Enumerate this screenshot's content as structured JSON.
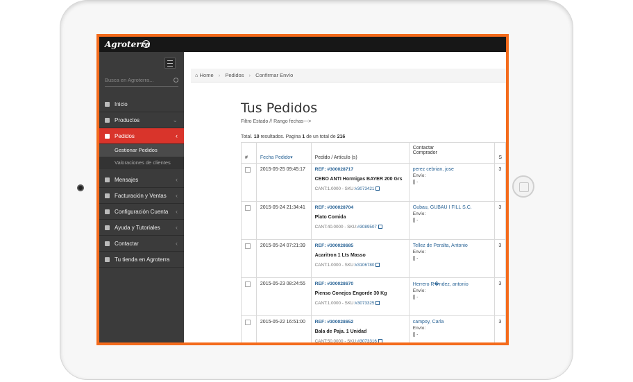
{
  "app": {
    "logo_text": "Agroterra"
  },
  "sidebar": {
    "search_placeholder": "Busca en Agroterra...",
    "items": [
      {
        "label": "Inicio",
        "icon": "home-icon",
        "chevron": ""
      },
      {
        "label": "Productos",
        "icon": "list-icon",
        "chevron": "⌄"
      },
      {
        "label": "Pedidos",
        "icon": "orders-icon",
        "chevron": "‹"
      },
      {
        "label": "Mensajes",
        "icon": "inbox-icon",
        "chevron": "‹"
      },
      {
        "label": "Facturación y Ventas",
        "icon": "euro-icon",
        "chevron": "‹"
      },
      {
        "label": "Configuración Cuenta",
        "icon": "gears-icon",
        "chevron": "‹"
      },
      {
        "label": "Ayuda y Tutoriales",
        "icon": "thumbs-up-icon",
        "chevron": "‹"
      },
      {
        "label": "Contactar",
        "icon": "megaphone-icon",
        "chevron": "‹"
      },
      {
        "label": "Tu tienda en Agroterra",
        "icon": "external-link-icon",
        "chevron": ""
      }
    ],
    "sub_items": [
      {
        "label": "Gestionar Pedidos"
      },
      {
        "label": "Valoraciones de clientes"
      }
    ]
  },
  "breadcrumb": {
    "home": "Home",
    "pedidos": "Pedidos",
    "current": "Confirmar Envío"
  },
  "page": {
    "title": "Tus Pedidos",
    "filter": "Filtro Estado // Rango fechas--->",
    "total_prefix": "Total.",
    "total_count": "10",
    "total_mid": "resultados. Pagina",
    "page_num": "1",
    "total_of": "de un total de",
    "total_pages": "216"
  },
  "table": {
    "headers": {
      "num": "#",
      "fecha": "Fecha Pedido",
      "pedido": "Pedido / Artículo (s)",
      "contactar_1": "Contactar",
      "contactar_2": "Comprador",
      "extra": "S"
    },
    "rows": [
      {
        "date": "2015-05-25 09:45:17",
        "ref": "REF: #300028717",
        "product": "CEBO ANTI Hormigas BAYER 200 Grs",
        "cant": "CANT:1.0000 - SKU:",
        "sku": "#3073421",
        "buyer": "perez cebrian, jose",
        "envio": "Envío:",
        "envio_val": "[] -",
        "extra": "3"
      },
      {
        "date": "2015-05-24 21:34:41",
        "ref": "REF: #300028704",
        "product": "Plato Comida",
        "cant": "CANT:40.0000 - SKU:",
        "sku": "#3089507",
        "buyer": "Gubau, GUBAU I FILL S.C.",
        "envio": "Envío:",
        "envio_val": "[] -",
        "extra": "3"
      },
      {
        "date": "2015-05-24 07:21:39",
        "ref": "REF: #300028685",
        "product": "Acaritron 1 Lts Masso",
        "cant": "CANT:1.0000 - SKU:",
        "sku": "#3106780",
        "buyer": "Tellez de Peralta, Antonio",
        "envio": "Envío:",
        "envio_val": "[] -",
        "extra": "3"
      },
      {
        "date": "2015-05-23 08:24:55",
        "ref": "REF: #300028670",
        "product": "Pienso Conejos Engorde 30 Kg",
        "cant": "CANT:1.0000 - SKU:",
        "sku": "#3073325",
        "buyer": "Herrero R�ndez, antonio",
        "envio": "Envío:",
        "envio_val": "[] -",
        "extra": "3"
      },
      {
        "date": "2015-05-22 16:51:00",
        "ref": "REF: #300028652",
        "product": "Bala de Paja. 1 Unidad",
        "cant": "CANT:50.0000 - SKU:",
        "sku": "#3073316",
        "buyer": "campoy, Carla",
        "envio": "Envío:",
        "envio_val": "[] -",
        "extra": "3"
      }
    ]
  },
  "colors": {
    "accent": "#d9342b",
    "frame": "#f46b1c",
    "link": "#2a6496",
    "sidebar": "#3b3b3b"
  }
}
